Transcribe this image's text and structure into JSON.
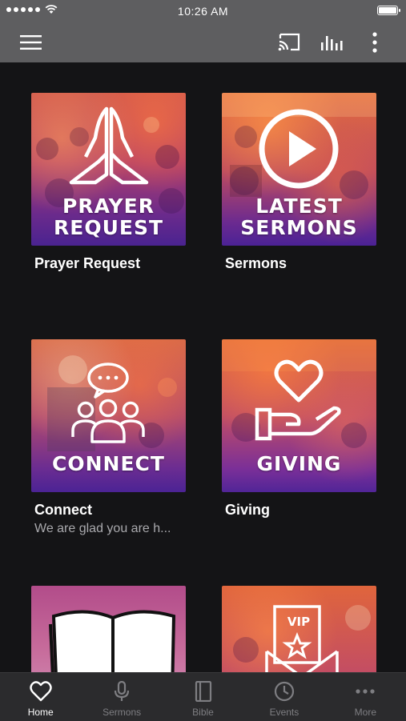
{
  "status_bar": {
    "time": "10:26 AM",
    "signal_bars": 5,
    "battery_level": 1.0
  },
  "app_bar": {
    "menu_icon": "hamburger-menu-icon",
    "cast_icon": "cast-icon",
    "audio_icon": "audio-bars-icon",
    "more_icon": "vertical-dots-icon"
  },
  "tiles": [
    {
      "overlay": [
        "PRAYER",
        "REQUEST"
      ],
      "title": "Prayer Request",
      "subtitle": "",
      "icon": "praying-hands-icon"
    },
    {
      "overlay": [
        "LATEST",
        "SERMONS"
      ],
      "title": "Sermons",
      "subtitle": "",
      "icon": "play-circle-icon"
    },
    {
      "overlay": [
        "CONNECT"
      ],
      "title": "Connect",
      "subtitle": "We are glad you are h...",
      "icon": "people-chat-icon"
    },
    {
      "overlay": [
        "GIVING"
      ],
      "title": "Giving",
      "subtitle": "",
      "icon": "heart-hand-icon"
    },
    {
      "overlay": [],
      "title": "",
      "subtitle": "",
      "icon": "open-book-icon"
    },
    {
      "overlay": [],
      "title": "",
      "subtitle": "",
      "icon": "vip-envelope-icon",
      "badge": "VIP"
    }
  ],
  "tab_bar": {
    "items": [
      {
        "label": "Home",
        "icon": "heart-icon",
        "active": true
      },
      {
        "label": "Sermons",
        "icon": "microphone-icon",
        "active": false
      },
      {
        "label": "Bible",
        "icon": "book-icon",
        "active": false
      },
      {
        "label": "Events",
        "icon": "clock-icon",
        "active": false
      },
      {
        "label": "More",
        "icon": "more-dots-icon",
        "active": false
      }
    ]
  },
  "colors": {
    "status_bar_bg": "#5e5e60",
    "page_bg": "#141416",
    "tab_bar_bg": "#2b2b2d",
    "tab_inactive": "#7e7e82",
    "tab_active": "#ffffff"
  }
}
